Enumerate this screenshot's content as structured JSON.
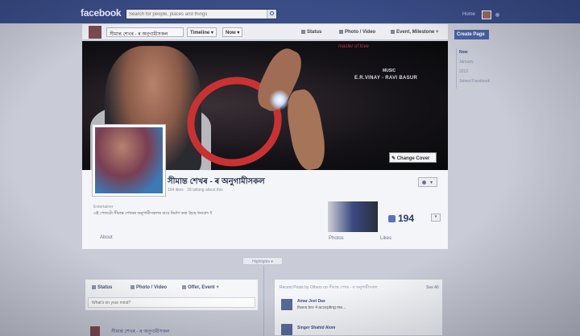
{
  "topbar": {
    "logo": "facebook",
    "search_placeholder": "Search for people, places and things",
    "home": "Home"
  },
  "page_header": {
    "page_name": "সীমান্ত শেখৰ - ৰ অনুগামীসকল",
    "timeline": "Timeline ▾",
    "now": "Now ▾",
    "status": "Status",
    "photo_video": "Photo / Video",
    "event_milestone": "Event, Milestone +"
  },
  "cover": {
    "tagline": "master of love",
    "music_label": "MUSIC",
    "music_credit": "E.R.VINAY - RAVI BASUR",
    "change_cover": "✎ Change Cover"
  },
  "info": {
    "page_name": "সীমান্ত শেখৰ - ৰ অনুগামীসকল",
    "stats": "194 likes · 28 talking about this",
    "gear_caret": "▾",
    "category": "Entertainer",
    "description": "এই পেজটো সীমান্ত শেখৰৰ অনুগামীসকলৰ বাবে নির্মাণ কৰা হৈছে ধন্যবাদ !!",
    "about": "About",
    "photos": "Photos",
    "like_count": "194",
    "likes": "Likes",
    "like_caret": "▾"
  },
  "sidebar": {
    "create_page": "Create Page",
    "items": [
      {
        "label": "Now",
        "active": true
      },
      {
        "label": "January",
        "active": false
      },
      {
        "label": "2012",
        "active": false
      },
      {
        "label": "Joined Facebook",
        "active": false
      }
    ]
  },
  "timeline": {
    "highlights": "Highlights ▾",
    "composer": {
      "status": "Status",
      "photo_video": "Photo / Video",
      "offer_event": "Offer, Event +",
      "placeholder": "What's on your mind?"
    },
    "recent": {
      "title": "Recent Posts by Others on সীমান্ত শেখৰ - ৰ অনুগামীসকল",
      "see_all": "See All",
      "posts": [
        {
          "name": "Amar Jeet Das",
          "text": "thanx bro 4 accepting me..."
        },
        {
          "name": "Singer Shahid Alom",
          "text": ""
        }
      ]
    },
    "bottom_post_name": "সীমান্ত শেখৰ - ৰ অনুগামীসকল"
  },
  "colors": {
    "topbar": "#3a4d86",
    "link": "#3a4f8a",
    "accent_red": "#c93232"
  }
}
